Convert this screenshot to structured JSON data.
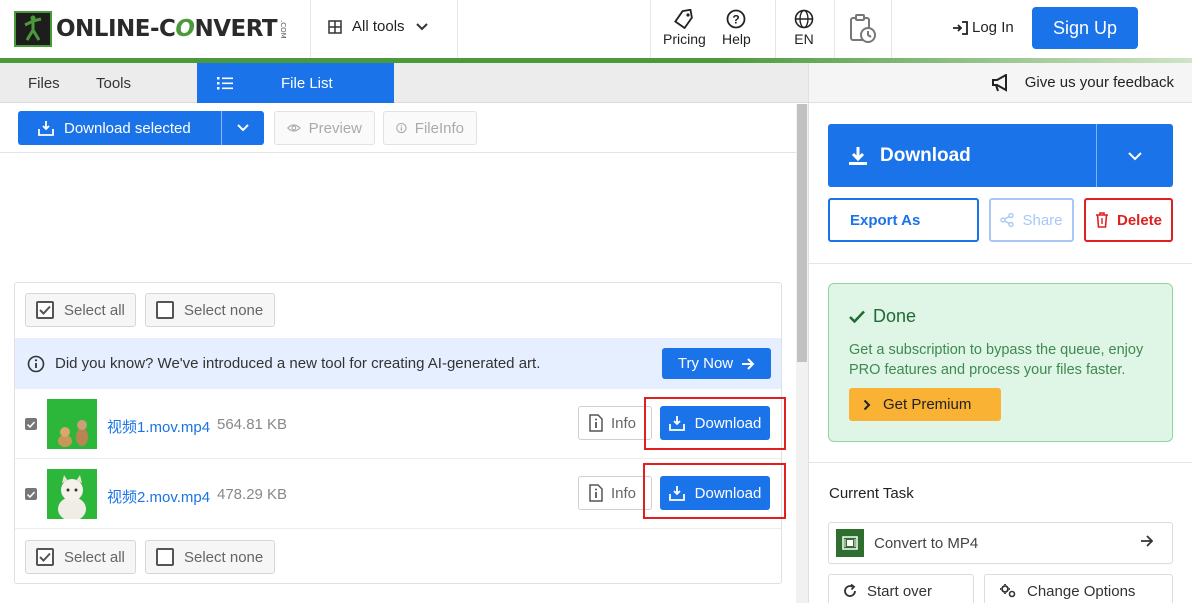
{
  "header": {
    "logo_text_1": "ONLINE-C",
    "logo_text_accent": "O",
    "logo_text_2": "NVERT",
    "logo_com": ".COM",
    "all_tools": "All tools",
    "pricing": "Pricing",
    "help": "Help",
    "language": "EN",
    "login": "Log In",
    "signup": "Sign Up"
  },
  "tabs": {
    "files": "Files",
    "tools": "Tools",
    "file_list": "File List"
  },
  "feedback": "Give us your feedback",
  "toolbar": {
    "download_selected": "Download selected",
    "preview": "Preview",
    "fileinfo": "FileInfo"
  },
  "list": {
    "select_all": "Select all",
    "select_none": "Select none",
    "notice": "Did you know? We've introduced a new tool for creating AI-generated art.",
    "try_now": "Try Now",
    "files": [
      {
        "name": "视频1.mov.mp4",
        "size": "564.81 KB",
        "info": "Info",
        "download": "Download"
      },
      {
        "name": "视频2.mov.mp4",
        "size": "478.29 KB",
        "info": "Info",
        "download": "Download"
      }
    ]
  },
  "right": {
    "download": "Download",
    "export_as": "Export As",
    "share": "Share",
    "delete": "Delete",
    "done_title": "Done",
    "done_text": "Get a subscription to bypass the queue, enjoy PRO features and process your files faster.",
    "get_premium": "Get Premium",
    "current_task": "Current Task",
    "task_name": "Convert to MP4",
    "start_over": "Start over",
    "change_options": "Change Options"
  },
  "colors": {
    "accent_blue": "#1a73e8",
    "brand_green": "#4a9a3c",
    "danger_red": "#e02020",
    "premium_yellow": "#f9b234"
  }
}
